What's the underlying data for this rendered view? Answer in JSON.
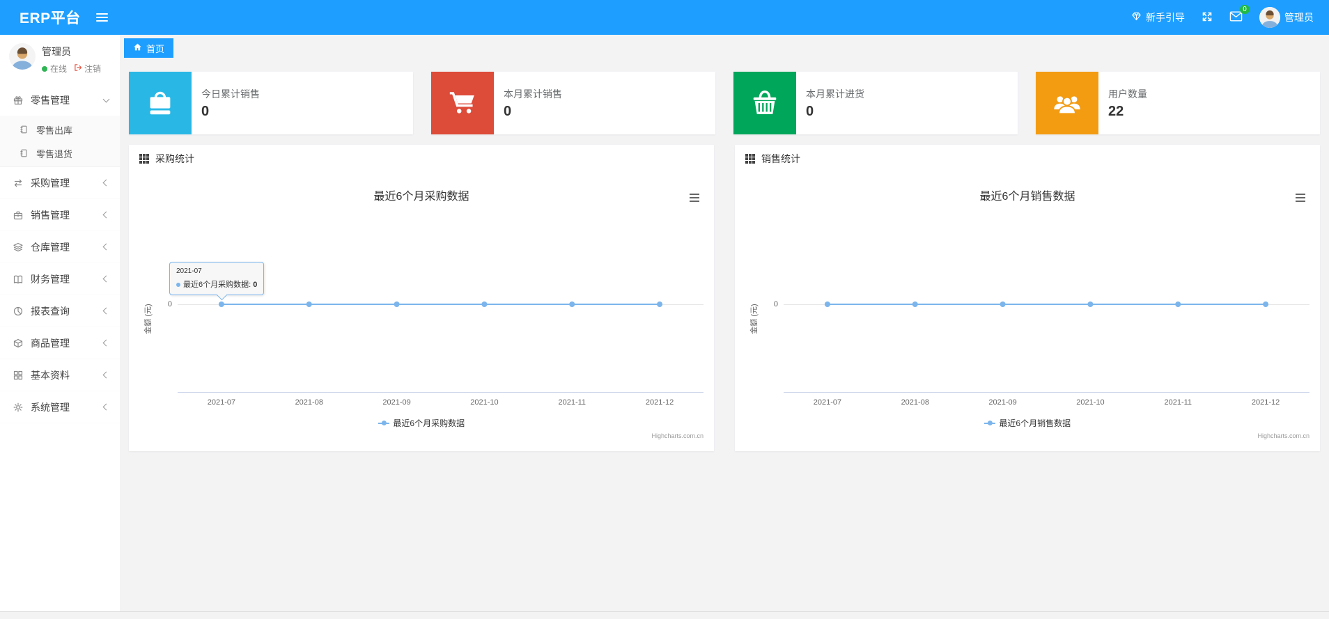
{
  "colors": {
    "accent": "#1e9fff",
    "badge_green": "#21ba45",
    "status_green": "#30b455",
    "logout_red": "#e25b4b",
    "chart_line": "#7cb5ec"
  },
  "navbar": {
    "brand": "ERP平台",
    "guide_label": "新手引导",
    "mail_badge": "0",
    "user_name": "管理员"
  },
  "tab": {
    "label": "首页"
  },
  "sidebar": {
    "user": {
      "name": "管理员",
      "status": "在线",
      "logout": "注销"
    },
    "menu": [
      {
        "label": "零售管理",
        "icon": "gift-icon",
        "expanded": true,
        "children": [
          {
            "label": "零售出库",
            "icon": "doc-icon"
          },
          {
            "label": "零售退货",
            "icon": "doc-icon"
          }
        ]
      },
      {
        "label": "采购管理",
        "icon": "exchange-icon"
      },
      {
        "label": "销售管理",
        "icon": "briefcase-icon"
      },
      {
        "label": "仓库管理",
        "icon": "layers-icon"
      },
      {
        "label": "财务管理",
        "icon": "book-icon"
      },
      {
        "label": "报表查询",
        "icon": "pie-icon"
      },
      {
        "label": "商品管理",
        "icon": "package-icon"
      },
      {
        "label": "基本资料",
        "icon": "grid-icon"
      },
      {
        "label": "系统管理",
        "icon": "gear-icon"
      }
    ]
  },
  "stat_cards": [
    {
      "label": "今日累计销售",
      "value": "0",
      "color": "#29b8e5",
      "icon": "shopping-bag-icon"
    },
    {
      "label": "本月累计销售",
      "value": "0",
      "color": "#dd4b39",
      "icon": "shopping-cart-icon"
    },
    {
      "label": "本月累计进货",
      "value": "0",
      "color": "#00a65a",
      "icon": "shopping-basket-icon"
    },
    {
      "label": "用户数量",
      "value": "22",
      "color": "#f39c12",
      "icon": "users-icon"
    }
  ],
  "panels": [
    {
      "title": "采购统计"
    },
    {
      "title": "销售统计"
    }
  ],
  "chart_data": [
    {
      "type": "line",
      "title": "最近6个月采购数据",
      "categories": [
        "2021-07",
        "2021-08",
        "2021-09",
        "2021-10",
        "2021-11",
        "2021-12"
      ],
      "series": [
        {
          "name": "最近6个月采购数据",
          "values": [
            0,
            0,
            0,
            0,
            0,
            0
          ]
        }
      ],
      "ylabel": "金额 (元)",
      "yticks": [
        "0"
      ],
      "grid": true,
      "legend_position": "bottom",
      "line_color": "#7cb5ec",
      "credits": "Highcharts.com.cn",
      "tooltip": {
        "category": "2021-07",
        "series": "最近6个月采购数据",
        "value": "0"
      }
    },
    {
      "type": "line",
      "title": "最近6个月销售数据",
      "categories": [
        "2021-07",
        "2021-08",
        "2021-09",
        "2021-10",
        "2021-11",
        "2021-12"
      ],
      "series": [
        {
          "name": "最近6个月销售数据",
          "values": [
            0,
            0,
            0,
            0,
            0,
            0
          ]
        }
      ],
      "ylabel": "金额 (元)",
      "yticks": [
        "0"
      ],
      "grid": true,
      "legend_position": "bottom",
      "line_color": "#7cb5ec",
      "credits": "Highcharts.com.cn"
    }
  ]
}
